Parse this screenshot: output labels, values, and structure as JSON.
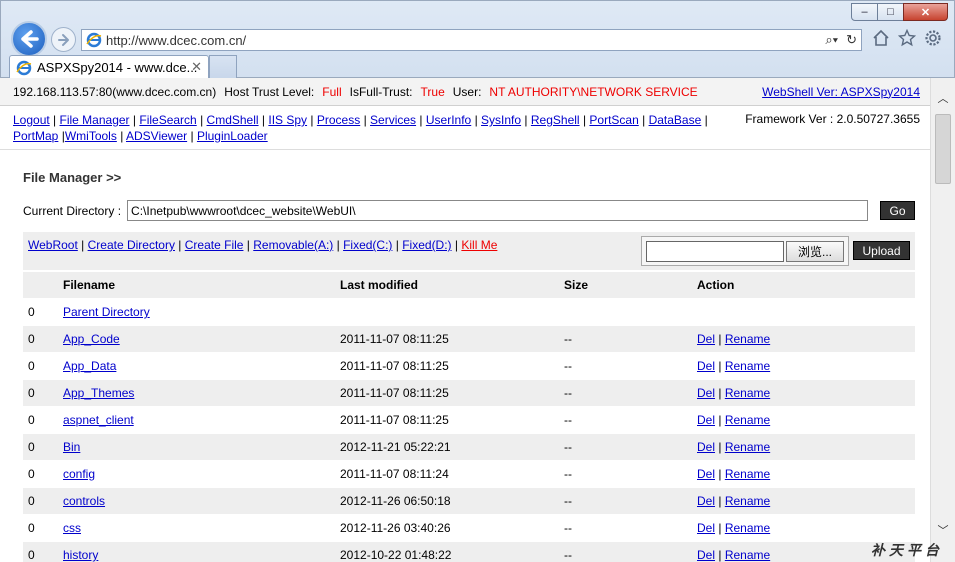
{
  "browser": {
    "url": "http://www.dcec.com.cn/",
    "tab_title": "ASPXSpy2014 - www.dce...",
    "tab_close": "✕",
    "window_buttons": [
      "–",
      "□",
      "✕"
    ],
    "icons": [
      "home-icon",
      "star-icon",
      "gear-icon"
    ]
  },
  "info": {
    "host": "192.168.113.57:80(www.dcec.com.cn)",
    "trust_label": "Host Trust Level:",
    "trust_value": "Full",
    "fulltrust_label": "IsFull-Trust:",
    "fulltrust_value": "True",
    "user_label": "User:",
    "user_value": "NT AUTHORITY\\NETWORK SERVICE",
    "version_link": "WebShell Ver: ASPXSpy2014"
  },
  "menu": [
    "Logout",
    "File Manager",
    "FileSearch",
    "CmdShell",
    "IIS Spy",
    "Process",
    "Services",
    "UserInfo",
    "SysInfo",
    "RegShell",
    "PortScan",
    "DataBase",
    "PortMap",
    "WmiTools",
    "ADSViewer",
    "PluginLoader"
  ],
  "framework": "Framework Ver : 2.0.50727.3655",
  "file_manager": {
    "title": "File Manager >>",
    "current_dir_label": "Current Directory :",
    "current_dir_value": "C:\\Inetpub\\wwwroot\\dcec_website\\WebUI\\",
    "go_label": "Go",
    "actions": [
      "WebRoot",
      "Create Directory",
      "Create File",
      "Removable(A:)",
      "Fixed(C:)",
      "Fixed(D:)"
    ],
    "kill_label": "Kill Me",
    "browse_label": "浏览...",
    "upload_label": "Upload"
  },
  "table": {
    "headers": {
      "filename": "Filename",
      "modified": "Last modified",
      "size": "Size",
      "action": "Action"
    },
    "del_label": "Del",
    "rename_label": "Rename",
    "rows": [
      {
        "flag": "0",
        "name": "Parent Directory",
        "modified": "",
        "size": "",
        "actions": false
      },
      {
        "flag": "0",
        "name": "App_Code",
        "modified": "2011-11-07 08:11:25",
        "size": "--",
        "actions": true
      },
      {
        "flag": "0",
        "name": "App_Data",
        "modified": "2011-11-07 08:11:25",
        "size": "--",
        "actions": true
      },
      {
        "flag": "0",
        "name": "App_Themes",
        "modified": "2011-11-07 08:11:25",
        "size": "--",
        "actions": true
      },
      {
        "flag": "0",
        "name": "aspnet_client",
        "modified": "2011-11-07 08:11:25",
        "size": "--",
        "actions": true
      },
      {
        "flag": "0",
        "name": "Bin",
        "modified": "2012-11-21 05:22:21",
        "size": "--",
        "actions": true
      },
      {
        "flag": "0",
        "name": "config",
        "modified": "2011-11-07 08:11:24",
        "size": "--",
        "actions": true
      },
      {
        "flag": "0",
        "name": "controls",
        "modified": "2012-11-26 06:50:18",
        "size": "--",
        "actions": true
      },
      {
        "flag": "0",
        "name": "css",
        "modified": "2012-11-26 03:40:26",
        "size": "--",
        "actions": true
      },
      {
        "flag": "0",
        "name": "history",
        "modified": "2012-10-22 01:48:22",
        "size": "--",
        "actions": true
      }
    ]
  },
  "watermark": "补天平台"
}
